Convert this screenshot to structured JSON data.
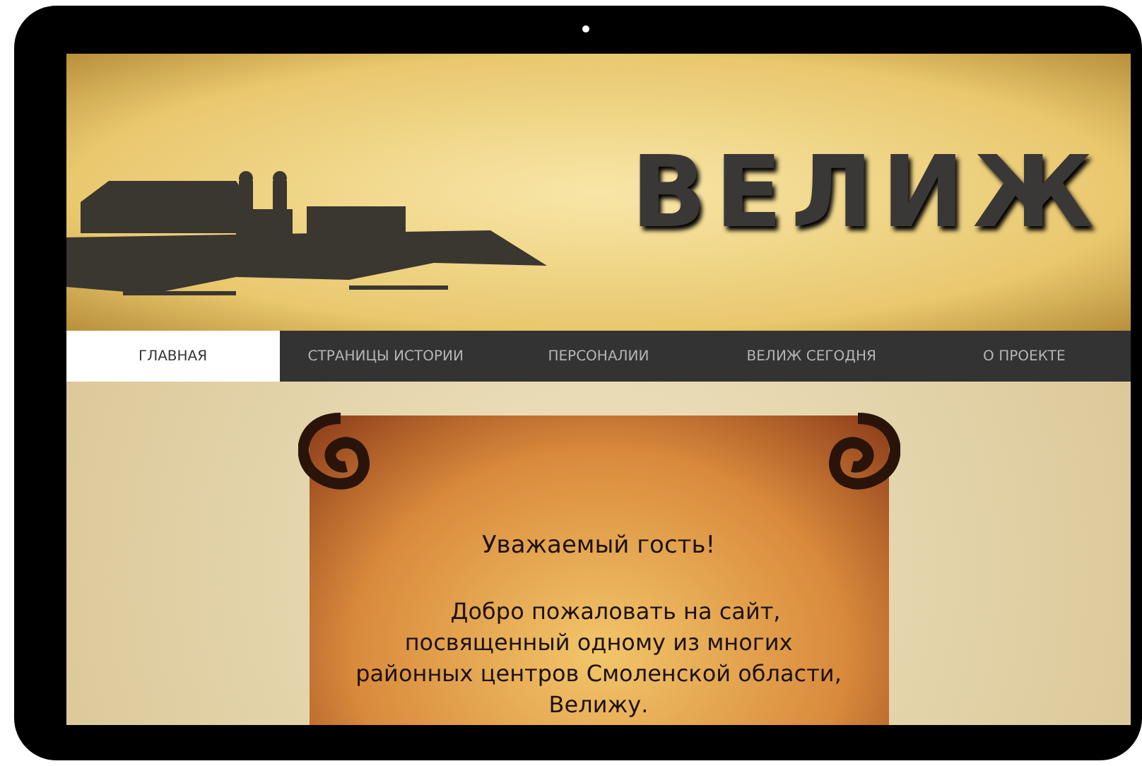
{
  "header": {
    "logo": "ВЕЛИЖ"
  },
  "nav": [
    {
      "label": "ГЛАВНАЯ",
      "selected": true
    },
    {
      "label": "СТРАНИЦЫ ИСТОРИИ",
      "selected": false
    },
    {
      "label": "ПЕРСОНАЛИИ",
      "selected": false
    },
    {
      "label": "ВЕЛИЖ СЕГОДНЯ",
      "selected": false
    },
    {
      "label": "О ПРОЕКТЕ",
      "selected": false
    }
  ],
  "scroll": {
    "heading": "Уважаемый гость!",
    "text": "Добро пожаловать на сайт, посвященный одному из многих районных центров Смоленской области, Велижу."
  }
}
